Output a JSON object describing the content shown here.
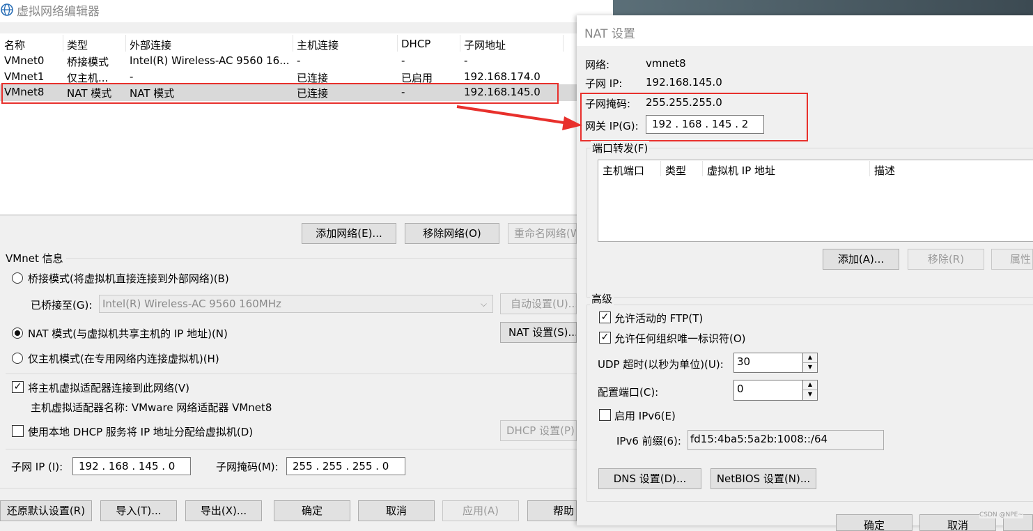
{
  "left_dialog": {
    "title": "虚拟网络编辑器",
    "columns": [
      "名称",
      "类型",
      "外部连接",
      "主机连接",
      "DHCP",
      "子网地址"
    ],
    "rows": [
      [
        "VMnet0",
        "桥接模式",
        "Intel(R) Wireless-AC 9560 16...",
        "-",
        "-",
        "-"
      ],
      [
        "VMnet1",
        "仅主机...",
        "-",
        "已连接",
        "已启用",
        "192.168.174.0"
      ],
      [
        "VMnet8",
        "NAT 模式",
        "NAT 模式",
        "已连接",
        "-",
        "192.168.145.0"
      ]
    ],
    "add_network": "添加网络(E)...",
    "remove_network": "移除网络(O)",
    "rename_network": "重命名网络(W)...",
    "vmnet_info": "VMnet 信息",
    "bridge_mode": "桥接模式(将虚拟机直接连接到外部网络)(B)",
    "bridged_to_label": "已桥接至(G):",
    "bridged_to_value": "Intel(R) Wireless-AC 9560 160MHz",
    "auto_settings": "自动设置(U)...",
    "nat_mode": "NAT 模式(与虚拟机共享主机的 IP 地址)(N)",
    "nat_settings": "NAT 设置(S)...",
    "host_only_mode": "仅主机模式(在专用网络内连接虚拟机)(H)",
    "connect_adapter": "将主机虚拟适配器连接到此网络(V)",
    "adapter_name": "主机虚拟适配器名称: VMware 网络适配器 VMnet8",
    "use_dhcp": "使用本地 DHCP 服务将 IP 地址分配给虚拟机(D)",
    "dhcp_settings": "DHCP 设置(P)",
    "subnet_ip_label": "子网 IP (I):",
    "subnet_ip_value": "192 . 168 . 145 .  0",
    "subnet_mask_label": "子网掩码(M):",
    "subnet_mask_value": "255 . 255 . 255 .  0",
    "restore_defaults": "还原默认设置(R)",
    "import": "导入(T)...",
    "export": "导出(X)...",
    "ok": "确定",
    "cancel": "取消",
    "apply": "应用(A)",
    "help": "帮助"
  },
  "nat_dialog": {
    "title": "NAT 设置",
    "network_label": "网络:",
    "network_value": "vmnet8",
    "subnet_ip_label": "子网 IP:",
    "subnet_ip_value": "192.168.145.0",
    "subnet_mask_label": "子网掩码:",
    "subnet_mask_value": "255.255.255.0",
    "gateway_label": "网关 IP(G):",
    "gateway_value": "192 . 168 . 145 .  2",
    "port_forwarding": "端口转发(F)",
    "pf_columns": [
      "主机端口",
      "类型",
      "虚拟机 IP 地址",
      "描述"
    ],
    "add": "添加(A)...",
    "remove": "移除(R)",
    "properties": "属性",
    "advanced": "高级",
    "allow_ftp": "允许活动的 FTP(T)",
    "allow_uid": "允许任何组织唯一标识符(O)",
    "udp_timeout_label": "UDP 超时(以秒为单位)(U):",
    "udp_timeout_value": "30",
    "config_port_label": "配置端口(C):",
    "config_port_value": "0",
    "enable_ipv6": "启用 IPv6(E)",
    "ipv6_prefix_label": "IPv6 前缀(6):",
    "ipv6_prefix_value": "fd15:4ba5:5a2b:1008::/64",
    "dns_settings": "DNS 设置(D)...",
    "netbios_settings": "NetBIOS 设置(N)...",
    "ok": "确定",
    "cancel": "取消"
  },
  "watermark": "CSDN @NPE~",
  "colors": {
    "highlight": "#e8302c",
    "selected_row": "#d9d9d9",
    "right_bg": "#4a5a63"
  }
}
